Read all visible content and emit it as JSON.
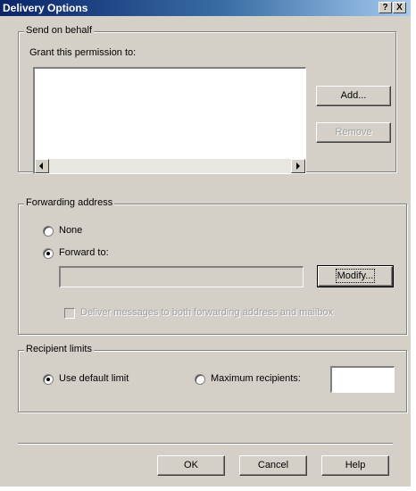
{
  "window": {
    "title": "Delivery Options",
    "help_btn": "?",
    "close_btn": "X"
  },
  "send_on_behalf": {
    "legend": "Send on behalf",
    "grant_label": "Grant this permission to:",
    "add_label": "Add...",
    "remove_label": "Remove"
  },
  "forwarding": {
    "legend": "Forwarding address",
    "none_label": "None",
    "forward_to_label": "Forward to:",
    "selected": "forward_to",
    "forward_value": "",
    "modify_label": "Modify...",
    "deliver_both_label": "Deliver messages to both forwarding address and mailbox",
    "deliver_both_checked": false
  },
  "recipient_limits": {
    "legend": "Recipient limits",
    "default_label": "Use default limit",
    "maximum_label": "Maximum recipients:",
    "selected": "default",
    "maximum_value": ""
  },
  "footer": {
    "ok_label": "OK",
    "cancel_label": "Cancel",
    "help_label": "Help"
  }
}
